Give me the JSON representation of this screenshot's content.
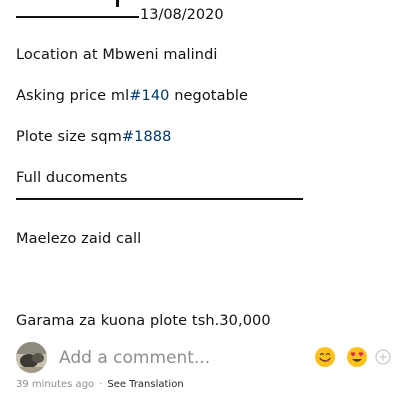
{
  "post": {
    "date": "13/08/2020",
    "location": "Location at Mbweni malindi",
    "price": {
      "prefix": "Asking price ml",
      "tag": "#140",
      "suffix": " negotable"
    },
    "size": {
      "prefix": "Plote size sqm",
      "tag": "#1888"
    },
    "documents": "Full ducoments",
    "contact": "Maelezo zaid call",
    "viewing_fee": "Garama za kuona plote tsh.30,000"
  },
  "comment": {
    "placeholder": "Add a comment...",
    "emoji_1": "😋",
    "emoji_2": "😍"
  },
  "meta": {
    "time_ago": "39 minutes ago",
    "separator": "·",
    "translate_label": "See Translation"
  },
  "colors": {
    "text": "#121212",
    "hashtag": "#00376b",
    "muted": "#8e8e8e"
  }
}
